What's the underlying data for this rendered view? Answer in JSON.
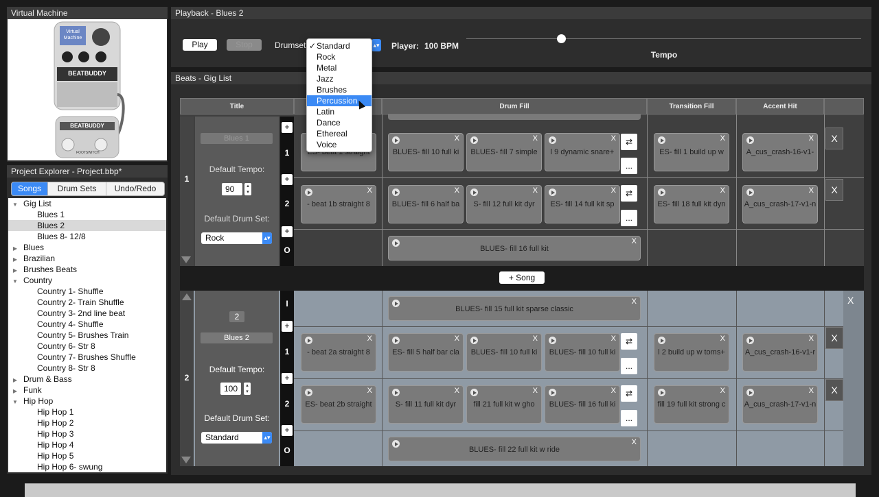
{
  "virtual_machine": {
    "title": "Virtual Machine",
    "display_text": "Virtual Machine",
    "brand": "BEATBUDDY",
    "footswitch_brand": "BEATBUDDY",
    "footswitch_label": "FOOTSWITCH"
  },
  "project_explorer": {
    "title": "Project Explorer - Project.bbp*",
    "tabs": [
      "Songs",
      "Drum Sets",
      "Undo/Redo"
    ],
    "tree": [
      {
        "label": "Gig List",
        "level": 0,
        "expanded": true
      },
      {
        "label": "Blues 1",
        "level": 1
      },
      {
        "label": "Blues 2",
        "level": 1,
        "selected": true
      },
      {
        "label": "Blues 8- 12/8",
        "level": 1
      },
      {
        "label": "Blues",
        "level": 0,
        "expanded": false
      },
      {
        "label": "Brazilian",
        "level": 0,
        "expanded": false
      },
      {
        "label": "Brushes Beats",
        "level": 0,
        "expanded": false
      },
      {
        "label": "Country",
        "level": 0,
        "expanded": true
      },
      {
        "label": "Country 1- Shuffle",
        "level": 1
      },
      {
        "label": "Country 2- Train Shuffle",
        "level": 1
      },
      {
        "label": "Country 3- 2nd line beat",
        "level": 1
      },
      {
        "label": "Country 4- Shuffle",
        "level": 1
      },
      {
        "label": "Country 5- Brushes Train",
        "level": 1
      },
      {
        "label": "Country 6- Str 8",
        "level": 1
      },
      {
        "label": "Country 7- Brushes Shuffle",
        "level": 1
      },
      {
        "label": "Country 8- Str 8",
        "level": 1
      },
      {
        "label": "Drum & Bass",
        "level": 0,
        "expanded": false
      },
      {
        "label": "Funk",
        "level": 0,
        "expanded": false
      },
      {
        "label": "Hip Hop",
        "level": 0,
        "expanded": true
      },
      {
        "label": "Hip Hop 1",
        "level": 1
      },
      {
        "label": "Hip Hop 2",
        "level": 1
      },
      {
        "label": "Hip Hop 3",
        "level": 1
      },
      {
        "label": "Hip Hop 4",
        "level": 1
      },
      {
        "label": "Hip Hop 5",
        "level": 1
      },
      {
        "label": "Hip Hop 6- swung",
        "level": 1
      }
    ]
  },
  "playback": {
    "title": "Playback - Blues 2",
    "play_label": "Play",
    "stop_label": "Stop",
    "drumset_label": "Drumset",
    "player_label": "Player:",
    "bpm_label": "100 BPM",
    "tempo_label": "Tempo",
    "tempo_position": 0.24
  },
  "drumset_menu": {
    "options": [
      "Standard",
      "Rock",
      "Metal",
      "Jazz",
      "Brushes",
      "Percussion",
      "Latin",
      "Dance",
      "Ethereal",
      "Voice"
    ],
    "checked": "Standard",
    "highlighted": "Percussion",
    "check_mark": "✓"
  },
  "beats": {
    "title": "Beats - Gig List",
    "headers": {
      "title": "Title",
      "drum_fill": "Drum Fill",
      "transition_fill": "Transition Fill",
      "accent_hit": "Accent Hit"
    },
    "add_song_label": "+ Song",
    "plus": "+",
    "dots": "...",
    "x": "X",
    "song1": {
      "number": "1",
      "name": "Blues 1",
      "default_tempo_label": "Default Tempo:",
      "tempo": "90",
      "default_drumset_label": "Default Drum Set:",
      "drumset": "Rock",
      "part1": {
        "num": "1",
        "main": "ES- beat 1 straight",
        "fills": [
          "BLUES- fill 10 full ki",
          "BLUES- fill 7 simple",
          "l 9 dynamic snare+"
        ],
        "transition": "ES- fill 1 build up w",
        "accent": "A_cus_crash-16-v1-"
      },
      "part2": {
        "num": "2",
        "main": "- beat 1b straight 8",
        "fills": [
          "BLUES- fill 6 half ba",
          "S- fill 12 full kit dyr",
          "ES- fill 14 full kit sp"
        ],
        "transition": "ES- fill 18 full kit dyn",
        "accent": "A_cus_crash-17-v1-n"
      },
      "outro": {
        "letter": "O",
        "fill": "BLUES- fill 16 full kit"
      }
    },
    "song2": {
      "number": "2",
      "name": "Blues 2",
      "default_tempo_label": "Default Tempo:",
      "tempo": "100",
      "default_drumset_label": "Default Drum Set:",
      "drumset": "Standard",
      "intro": {
        "letter": "I",
        "fill": "BLUES- fill 15 full kit sparse classic"
      },
      "part1": {
        "num": "1",
        "main": "- beat 2a straight 8",
        "fills": [
          "ES- fill 5 half bar cla",
          "BLUES- fill 10 full ki",
          "BLUES- fill 10 full ki"
        ],
        "transition": "l 2 build up w toms+",
        "accent": "A_cus_crash-16-v1-r"
      },
      "part2": {
        "num": "2",
        "main": "ES- beat 2b straight",
        "fills": [
          "S- fill 11 full kit dyr",
          "fill 21 full kit w gho",
          "BLUES- fill 16 full ki"
        ],
        "transition": "fill 19 full kit strong c",
        "accent": "A_cus_crash-17-v1-n"
      },
      "outro": {
        "letter": "O",
        "fill": "BLUES- fill 22 full kit w ride"
      }
    }
  }
}
